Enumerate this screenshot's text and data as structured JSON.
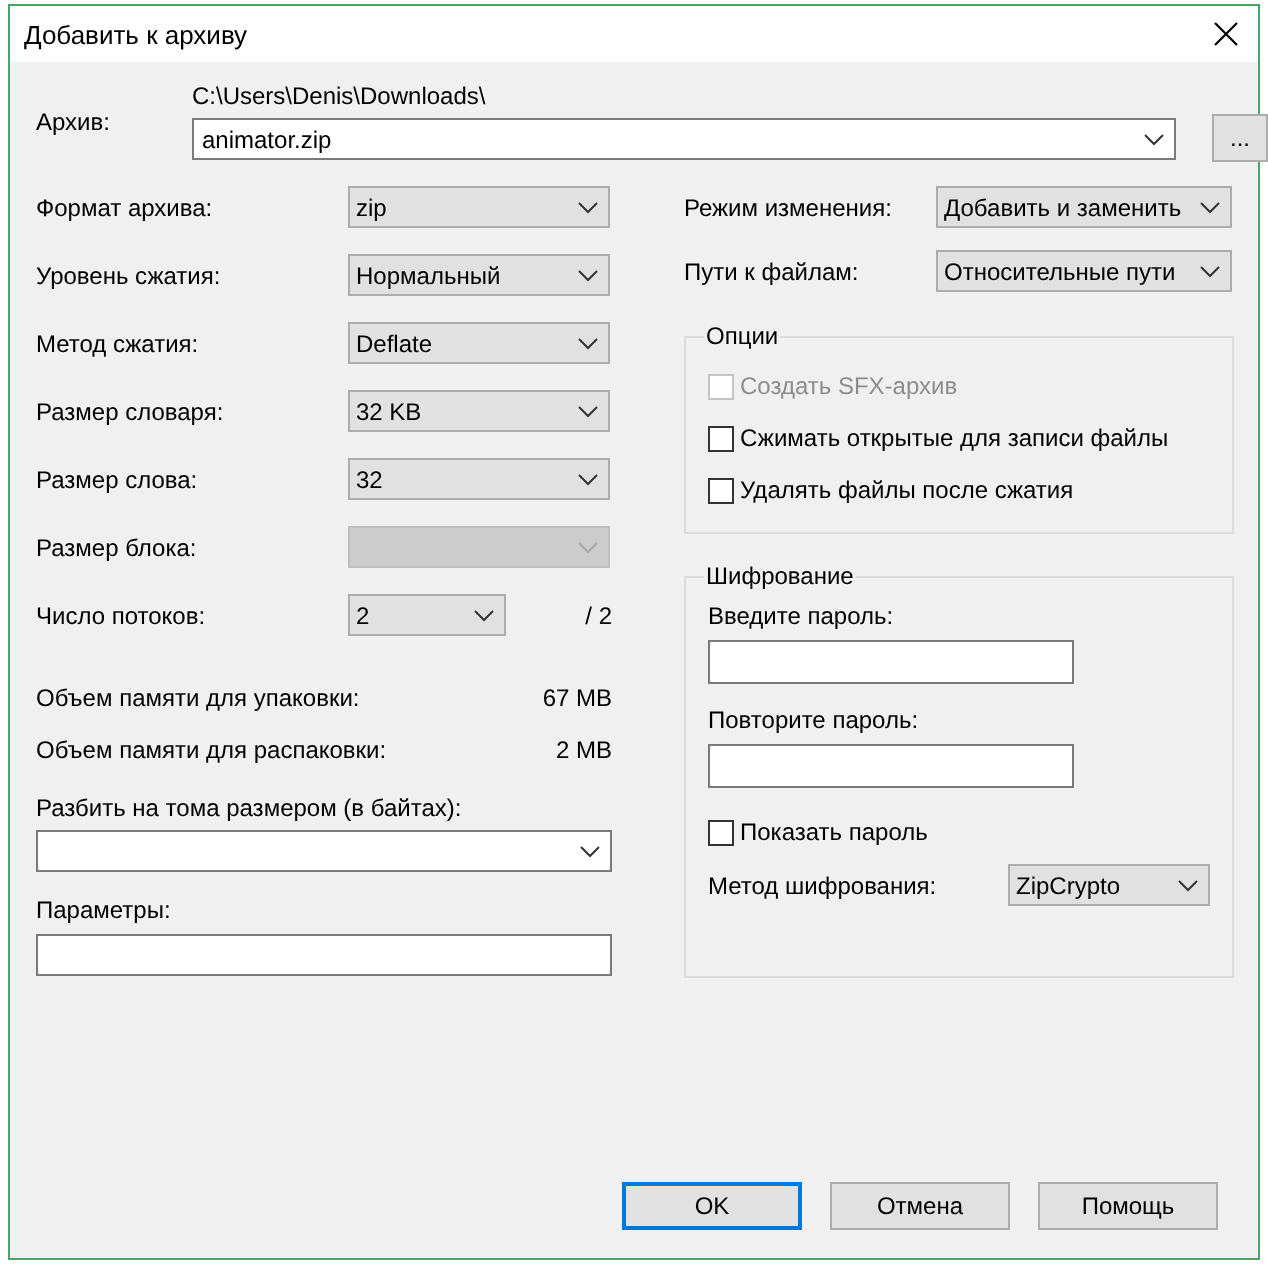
{
  "window": {
    "title": "Добавить к архиву"
  },
  "archive": {
    "label": "Архив:",
    "path": "C:\\Users\\Denis\\Downloads\\",
    "value": "animator.zip",
    "browse": "..."
  },
  "left_fields": [
    {
      "kind": "select",
      "label": "Формат архива:",
      "value": "zip",
      "disabled": false
    },
    {
      "kind": "select",
      "label": "Уровень сжатия:",
      "value": "Нормальный",
      "disabled": false
    },
    {
      "kind": "select",
      "label": "Метод сжатия:",
      "value": "Deflate",
      "disabled": false
    },
    {
      "kind": "select",
      "label": "Размер словаря:",
      "value": "32 KB",
      "disabled": false
    },
    {
      "kind": "select",
      "label": "Размер слова:",
      "value": "32",
      "disabled": false
    },
    {
      "kind": "select",
      "label": "Размер блока:",
      "disabled": true
    },
    {
      "kind": "threads",
      "label": "Число потоков:",
      "value": "2",
      "disabled": false,
      "max": "/ 2"
    }
  ],
  "memory": [
    {
      "label": "Объем памяти для упаковки:",
      "value": "67 MB"
    },
    {
      "label": "Объем памяти для распаковки:",
      "value": "2 MB"
    }
  ],
  "split": {
    "label": "Разбить на тома размером (в байтах):"
  },
  "parameters": {
    "label": "Параметры:"
  },
  "right_fields": [
    {
      "label": "Режим изменения:",
      "value": "Добавить и заменить"
    },
    {
      "label": "Пути к файлам:",
      "value": "Относительные пути"
    }
  ],
  "options": {
    "title": "Опции",
    "items": [
      {
        "label": "Создать SFX-архив",
        "checked": false,
        "disabled": true
      },
      {
        "label": "Сжимать открытые для записи файлы",
        "checked": false,
        "disabled": false
      },
      {
        "label": "Удалять файлы после сжатия",
        "checked": false,
        "disabled": false
      }
    ]
  },
  "encryption": {
    "title": "Шифрование",
    "password_label": "Введите пароль:",
    "repeat_label": "Повторите пароль:",
    "show": {
      "label": "Показать пароль",
      "checked": false,
      "disabled": false
    },
    "method_label": "Метод шифрования:",
    "method": "ZipCrypto"
  },
  "buttons": [
    {
      "label": "OK",
      "default": true
    },
    {
      "label": "Отмена",
      "default": false
    },
    {
      "label": "Помощь",
      "default": false
    }
  ]
}
